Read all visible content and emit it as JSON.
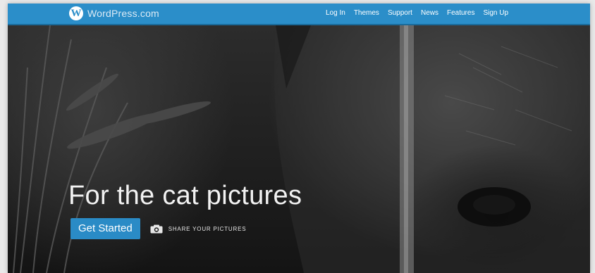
{
  "header": {
    "logo_letter": "W",
    "site_name": "WordPress.com",
    "nav": [
      {
        "label": "Log In"
      },
      {
        "label": "Themes"
      },
      {
        "label": "Support"
      },
      {
        "label": "News"
      },
      {
        "label": "Features"
      },
      {
        "label": "Sign Up"
      }
    ]
  },
  "hero": {
    "headline": "For the cat pictures",
    "cta_label": "Get Started",
    "share_label": "SHARE YOUR PICTURES",
    "share_icon": "camera-icon",
    "prev_arrow": "←",
    "next_arrow": "→"
  },
  "colors": {
    "header_bg": "#2b8ec9",
    "cta_bg": "#2a8bc6",
    "headline": "#f2f2f2"
  }
}
